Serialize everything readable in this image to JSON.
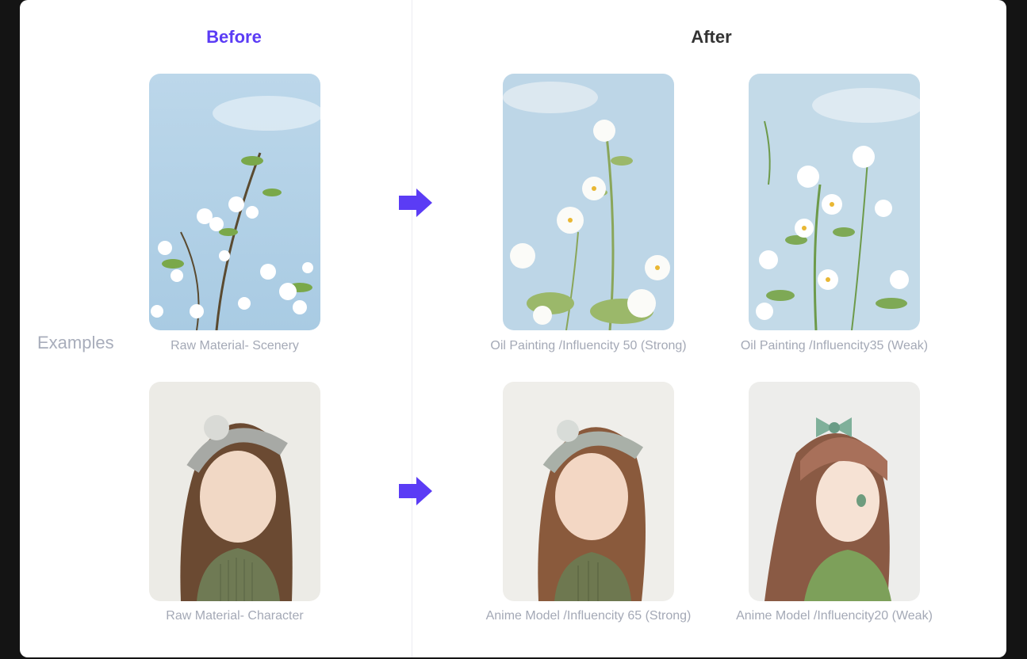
{
  "headings": {
    "before": "Before",
    "after": "After"
  },
  "side_label": "Examples",
  "rows": [
    {
      "before_caption": "Raw Material- Scenery",
      "after_captions": [
        "Oil Painting /Influencity 50 (Strong)",
        "Oil Painting /Influencity35 (Weak)"
      ]
    },
    {
      "before_caption": "Raw Material- Character",
      "after_captions": [
        "Anime Model /Influencity 65 (Strong)",
        "Anime Model /Influencity20 (Weak)"
      ]
    }
  ],
  "colors": {
    "accent": "#5b3cf5",
    "caption": "#a4a9b6",
    "label": "#a8adbb"
  },
  "icons": {
    "arrow": "arrow-right-icon"
  }
}
